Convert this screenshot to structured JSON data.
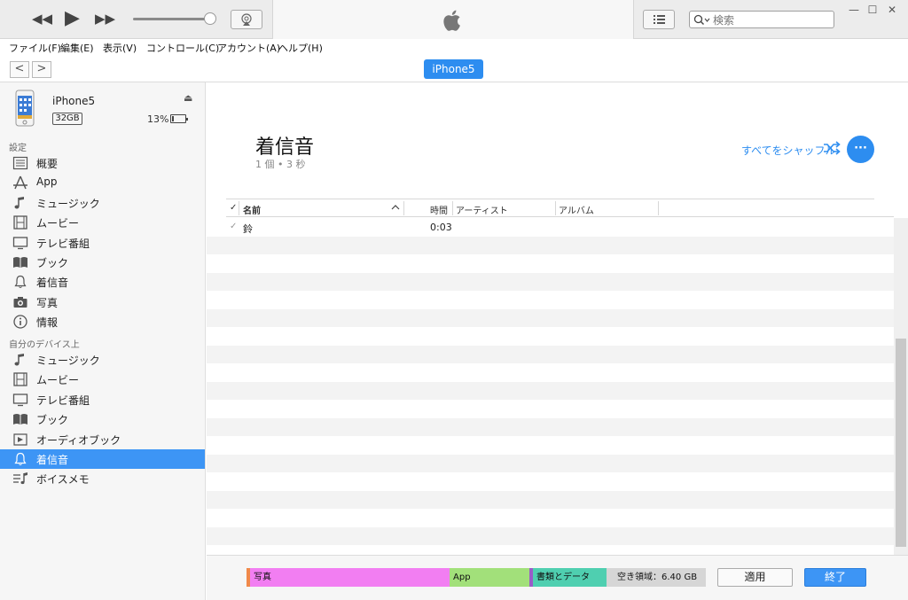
{
  "window": {
    "minimize": "—",
    "maximize": "☐",
    "close": "✕"
  },
  "search": {
    "placeholder": "検索"
  },
  "menu": [
    "ファイル(F)",
    "編集(E)",
    "表示(V)",
    "コントロール(C)",
    "アカウント(A)",
    "ヘルプ(H)"
  ],
  "nav": {
    "back": "<",
    "forward": ">",
    "device_pill": "iPhone5"
  },
  "device": {
    "name": "iPhone5",
    "capacity": "32GB",
    "battery_percent": "13%",
    "battery_level": 0.13
  },
  "sidebar": {
    "settings_header": "設定",
    "settings_items": [
      {
        "label": "概要",
        "icon": "summary-icon"
      },
      {
        "label": "App",
        "icon": "app-store-icon"
      },
      {
        "label": "ミュージック",
        "icon": "music-note-icon"
      },
      {
        "label": "ムービー",
        "icon": "film-icon"
      },
      {
        "label": "テレビ番組",
        "icon": "tv-icon"
      },
      {
        "label": "ブック",
        "icon": "book-icon"
      },
      {
        "label": "着信音",
        "icon": "bell-icon"
      },
      {
        "label": "写真",
        "icon": "camera-icon"
      },
      {
        "label": "情報",
        "icon": "info-icon"
      }
    ],
    "ondevice_header": "自分のデバイス上",
    "ondevice_items": [
      {
        "label": "ミュージック",
        "icon": "music-note-icon"
      },
      {
        "label": "ムービー",
        "icon": "film-icon"
      },
      {
        "label": "テレビ番組",
        "icon": "tv-icon"
      },
      {
        "label": "ブック",
        "icon": "book-icon"
      },
      {
        "label": "オーディオブック",
        "icon": "audiobook-icon"
      },
      {
        "label": "着信音",
        "icon": "bell-icon",
        "selected": true
      },
      {
        "label": "ボイスメモ",
        "icon": "voice-memo-icon"
      }
    ]
  },
  "main": {
    "title": "着信音",
    "subtitle": "1 個 • 3 秒",
    "shuffle_label": "すべてをシャッフル",
    "more_label": "···",
    "table": {
      "columns": {
        "check": "✓",
        "name": "名前",
        "time": "時間",
        "artist": "アーティスト",
        "album": "アルバム"
      },
      "rows": [
        {
          "checked": "✓",
          "name": "鈴",
          "time": "0:03",
          "artist": "",
          "album": ""
        }
      ]
    }
  },
  "storage": {
    "segments": [
      {
        "label": "写真",
        "color": "#f27ef2"
      },
      {
        "label": "App",
        "color": "#a2e07a"
      },
      {
        "label": "書類とデータ",
        "color": "#4fcfb0"
      },
      {
        "label": "空き領域：6.40 GB",
        "color": "#d6d6d6"
      }
    ],
    "apply_label": "適用",
    "done_label": "終了"
  },
  "colors": {
    "accent": "#2d8df0",
    "selected_bg": "#3d95f5"
  }
}
